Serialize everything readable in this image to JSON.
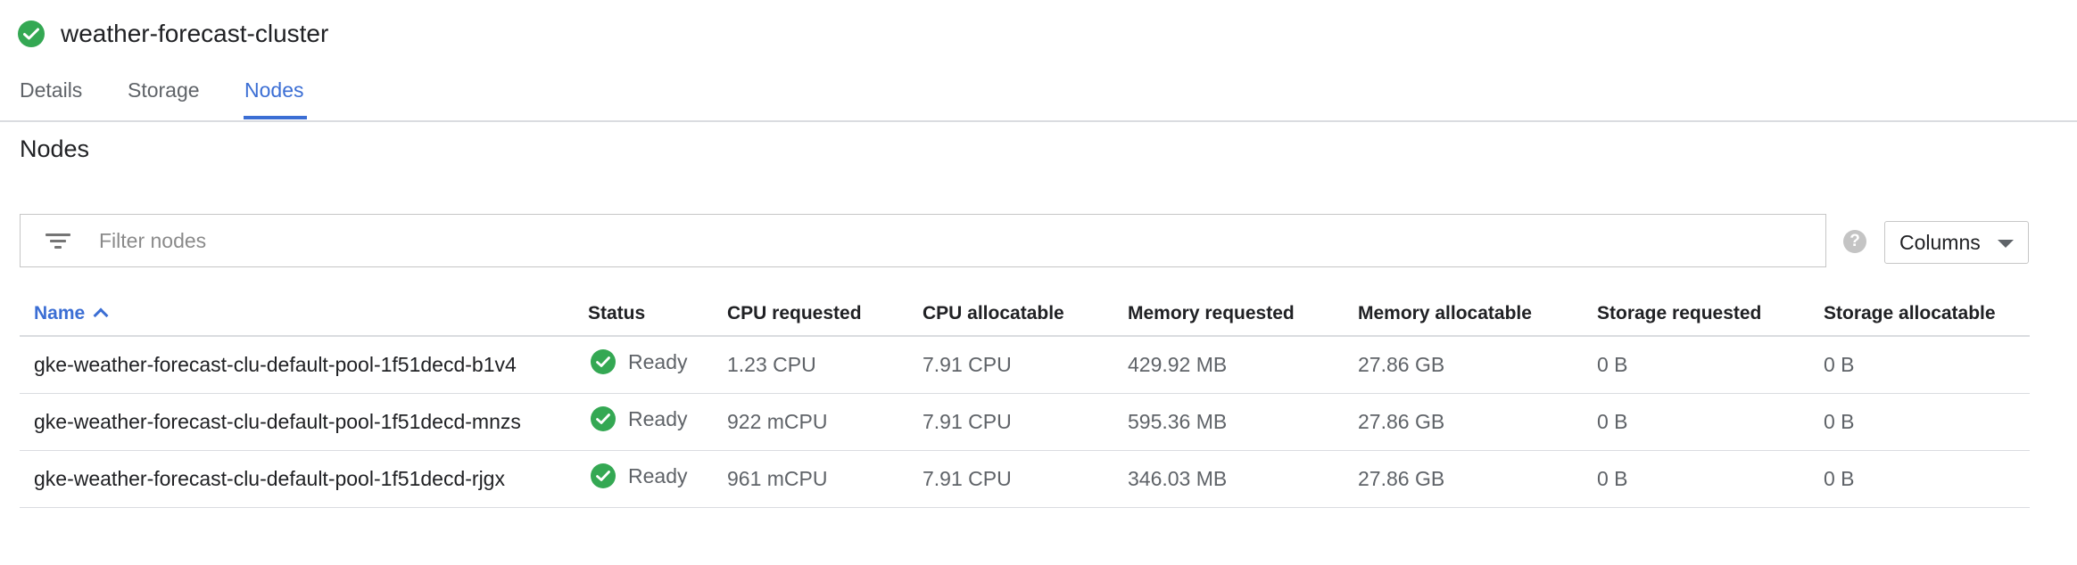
{
  "cluster": {
    "title": "weather-forecast-cluster",
    "status_icon": "check-circle-icon",
    "status_color": "#34a853"
  },
  "tabs": [
    {
      "label": "Details",
      "active": false
    },
    {
      "label": "Storage",
      "active": false
    },
    {
      "label": "Nodes",
      "active": true
    }
  ],
  "section": {
    "title": "Nodes"
  },
  "filter": {
    "placeholder": "Filter nodes",
    "value": "",
    "icon": "filter-icon"
  },
  "help": {
    "icon": "help-icon",
    "label": "?"
  },
  "columns_button": {
    "label": "Columns",
    "icon": "caret-down-icon"
  },
  "table": {
    "sort": {
      "column": "Name",
      "direction": "ascending"
    },
    "headers": [
      "Name",
      "Status",
      "CPU requested",
      "CPU allocatable",
      "Memory requested",
      "Memory allocatable",
      "Storage requested",
      "Storage allocatable"
    ],
    "rows": [
      {
        "name": "gke-weather-forecast-clu-default-pool-1f51decd-b1v4",
        "status": "Ready",
        "cpu_requested": "1.23 CPU",
        "cpu_allocatable": "7.91 CPU",
        "memory_requested": "429.92 MB",
        "memory_allocatable": "27.86 GB",
        "storage_requested": "0 B",
        "storage_allocatable": "0 B"
      },
      {
        "name": "gke-weather-forecast-clu-default-pool-1f51decd-mnzs",
        "status": "Ready",
        "cpu_requested": "922 mCPU",
        "cpu_allocatable": "7.91 CPU",
        "memory_requested": "595.36 MB",
        "memory_allocatable": "27.86 GB",
        "storage_requested": "0 B",
        "storage_allocatable": "0 B"
      },
      {
        "name": "gke-weather-forecast-clu-default-pool-1f51decd-rjgx",
        "status": "Ready",
        "cpu_requested": "961 mCPU",
        "cpu_allocatable": "7.91 CPU",
        "memory_requested": "346.03 MB",
        "memory_allocatable": "27.86 GB",
        "storage_requested": "0 B",
        "storage_allocatable": "0 B"
      }
    ]
  },
  "colors": {
    "accent": "#3b6ed4",
    "success": "#34a853",
    "text": "#202124",
    "muted": "#5f6368",
    "divider": "#dadce0"
  }
}
